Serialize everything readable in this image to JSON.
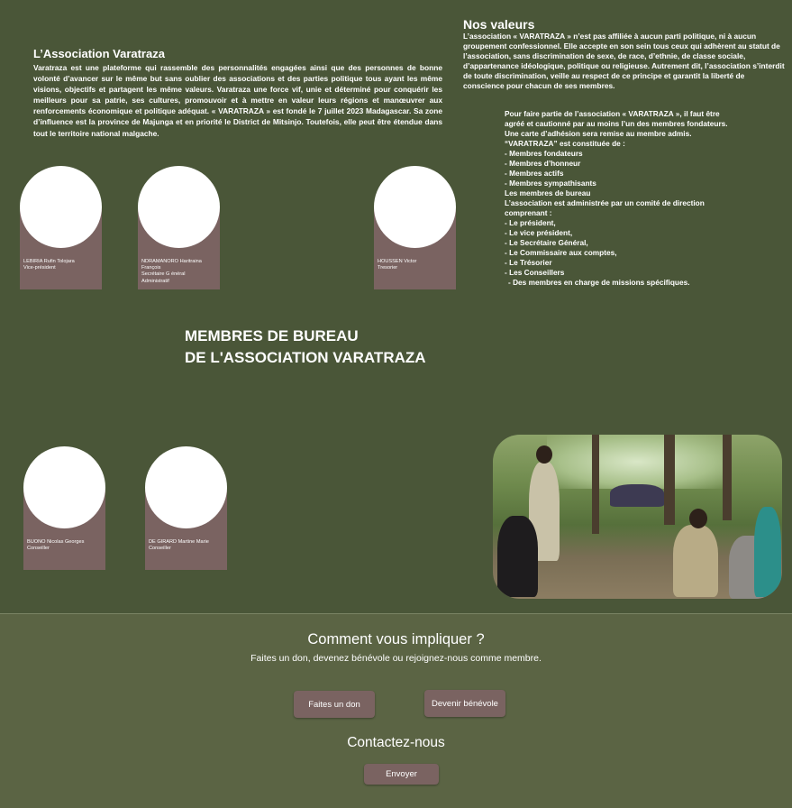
{
  "association": {
    "title": "L’Association Varatraza",
    "text": "Varatraza est une plateforme qui rassemble des personnalités engagées ainsi que des personnes de bonne volonté d’avancer sur le même but sans oublier des associations et des parties politique tous ayant les même visions, objectifs et partagent les même valeurs. Varatraza une force vif, unie et déterminé pour conquérir les meilleurs pour sa patrie, ses cultures, promouvoir et à mettre en valeur leurs régions et manœuvrer aux renforcements économique et politique adéquat. « VARATRAZA » est fondé le 7 juillet 2023 Madagascar. Sa zone d’influence est la province de Majunga et en priorité le District de Mitsinjo. Toutefois, elle peut être étendue dans tout le territoire national malgache."
  },
  "values": {
    "title": "Nos valeurs",
    "text": "L’association « VARATRAZA » n’est pas affiliée à aucun parti politique, ni à aucun groupement confessionnel. Elle accepte en son sein tous ceux qui adhèrent au statut de l’association, sans discrimination de sexe, de race, d’ethnie, de classe sociale, d’appartenance idéologique, politique ou religieuse. Autrement dit, l’association s’interdit de toute discrimination, veille au respect de ce principe et garantit la liberté de conscience pour chacun de ses membres."
  },
  "membership": {
    "lines": [
      "Pour faire partie de l’association « VARATRAZA », il faut être",
      "agréé et cautionné par au moins l’un des membres fondateurs.",
      "Une carte d’adhésion sera remise au membre admis.",
      "“VARATRAZA” est constituée de :",
      "-  Membres fondateurs",
      "-  Membres d’honneur",
      "-  Membres actifs",
      "-  Membres sympathisants",
      "Les membres de bureau",
      "L’association est administrée par un comité de direction",
      "comprenant :",
      "- Le président,",
      "- Le vice président,",
      "- Le Secrétaire Général,",
      "- Le Commissaire aux comptes,",
      "- Le Trésorier",
      "- Les Conseillers",
      "  - Des membres en charge de missions spécifiques."
    ]
  },
  "members_title": [
    "MEMBRES DE BUREAU",
    "DE L'ASSOCIATION VARATRAZA"
  ],
  "members": [
    {
      "lines": [
        "LEBIRIA Rufin Tolojara",
        "Vice-président"
      ]
    },
    {
      "lines": [
        "NDRAMANORO Haritraina",
        "François",
        "Secrétaire G énéral",
        "Administratif"
      ]
    },
    {
      "lines": [
        "HOUSSEN Victor",
        "Tresorier"
      ]
    },
    {
      "lines": [
        "BUONO Nicolas Georges",
        "Conseiller"
      ]
    },
    {
      "lines": [
        "DE GIRARD Martine Marie",
        "Conseiller"
      ]
    }
  ],
  "cta": {
    "title": "Comment vous impliquer ?",
    "subtitle": "Faites un don, devenez bénévole ou rejoignez-nous comme membre.",
    "donate_label": "Faites un don",
    "volunteer_label": "Devenir bénévole"
  },
  "contact": {
    "title": "Contactez-nous",
    "send_label": "Envoyer"
  },
  "colors": {
    "background": "#4a5638",
    "footer": "#5b6444",
    "card": "#7a6361"
  }
}
